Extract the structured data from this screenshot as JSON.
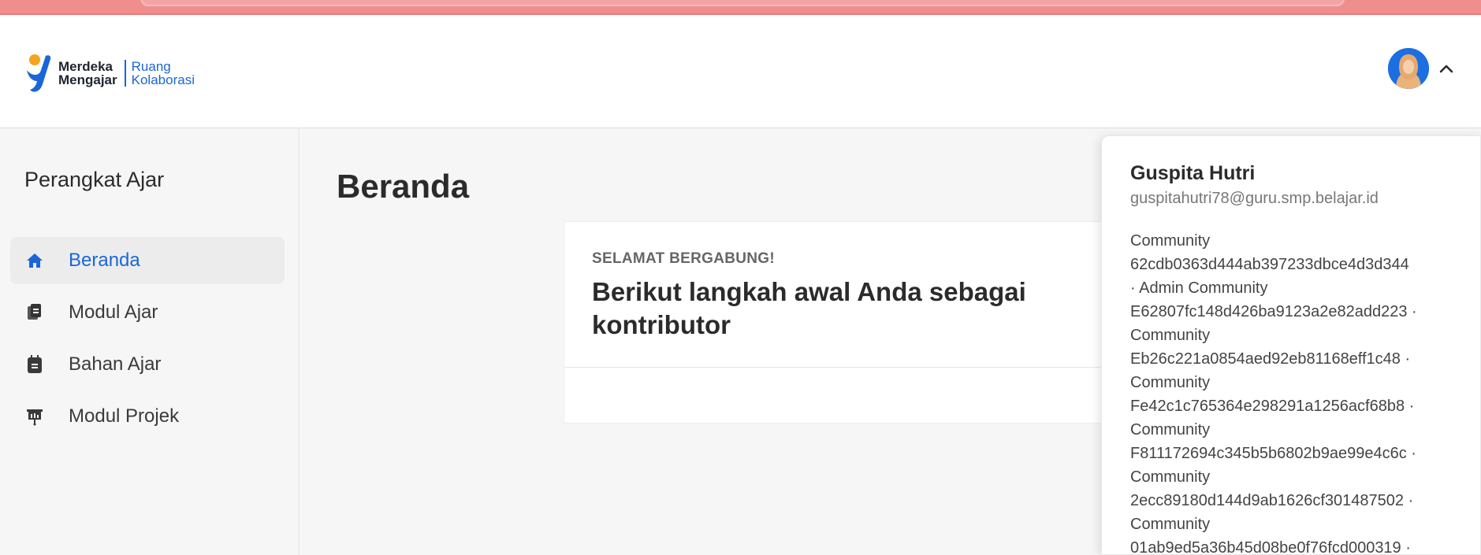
{
  "brand": {
    "main_line1": "Merdeka",
    "main_line2": "Mengajar",
    "sub_line1": "Ruang",
    "sub_line2": "Kolaborasi",
    "primary_color": "#1a66d9",
    "accent_color": "#f4a51c"
  },
  "header": {
    "avatar_icon": "user-avatar",
    "chevron_icon": "chevron-up-icon"
  },
  "sidebar": {
    "title": "Perangkat Ajar",
    "items": [
      {
        "label": "Beranda",
        "icon": "home-icon",
        "active": true
      },
      {
        "label": "Modul Ajar",
        "icon": "documents-icon",
        "active": false
      },
      {
        "label": "Bahan Ajar",
        "icon": "notebook-icon",
        "active": false
      },
      {
        "label": "Modul Projek",
        "icon": "presentation-board-icon",
        "active": false
      }
    ]
  },
  "main": {
    "title": "Beranda",
    "card": {
      "kicker": "SELAMAT BERGABUNG!",
      "heading_line1": "Berikut langkah awal Anda sebagai",
      "heading_line2": "kontributor"
    }
  },
  "profile_menu": {
    "name": "Guspita Hutri",
    "email": "guspitahutri78@guru.smp.belajar.id",
    "roles_text": [
      "Community",
      "62cdb0363d444ab397233dbce4d3d344",
      "· Admin Community",
      "E62807fc148d426ba9123a2e82add223 ·",
      "Community",
      "Eb26c221a0854aed92eb81168eff1c48 ·",
      "Community",
      "Fe42c1c765364e298291a1256acf68b8 ·",
      "Community",
      "F811172694c345b5b6802b9ae99e4c6c ·",
      "Community",
      "2ecc89180d144d9ab1626cf301487502 ·",
      "Community",
      "01ab9ed5a36b45d08be0f76fcd000319 ·"
    ]
  }
}
